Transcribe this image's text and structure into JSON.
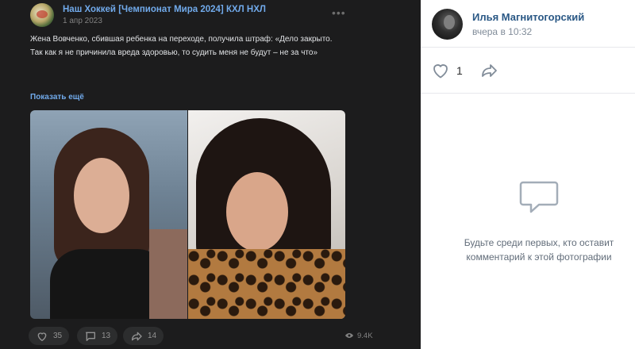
{
  "post": {
    "group_name": "Наш Хоккей [Чемпионат Мира 2024] КХЛ НХЛ",
    "date": "1 апр 2023",
    "text_line1": "Жена Вовченко, сбившая ребенка на переходе, получила штраф: «Дело закрыто.",
    "text_line2": "Так как я не причинила вреда здоровью, то судить меня не будут – не за что»",
    "show_more": "Показать ещё",
    "likes": "35",
    "comments": "13",
    "shares": "14",
    "views": "9.4K"
  },
  "photo_viewer": {
    "author_name": "Илья Магнитогорский",
    "author_time": "вчера в 10:32",
    "like_count": "1",
    "empty_line1": "Будьте среди первых, кто оставит",
    "empty_line2": "комментарий к этой фотографии"
  },
  "colors": {
    "dark_bg": "#1c1c1d",
    "link_blue": "#71aaeb",
    "author_blue": "#2a5885",
    "muted": "#818c99"
  }
}
